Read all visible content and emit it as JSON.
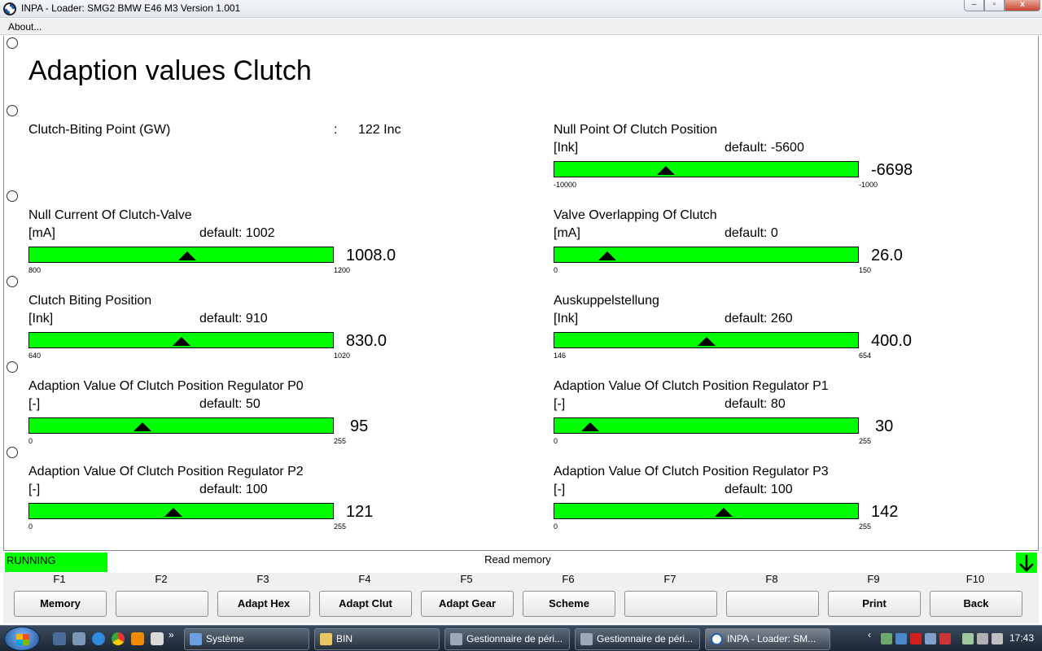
{
  "window": {
    "title": "INPA - Loader:  SMG2 BMW E46 M3 Version 1.001"
  },
  "menu": {
    "about": "About..."
  },
  "page": {
    "title": "Adaption values Clutch"
  },
  "biting_point": {
    "label": "Clutch-Biting Point (GW)",
    "sep": ":",
    "value": "122 Inc"
  },
  "gauges": [
    {
      "name": "Null Point Of Clutch Position",
      "unit": "[Ink]",
      "default": "default: -5600",
      "min": "-10000",
      "max": "-1000",
      "value": "-6698",
      "fraction": 0.367
    },
    {
      "name": "Null Current Of Clutch-Valve",
      "unit": "[mA]",
      "default": "default: 1002",
      "min": "800",
      "max": "1200",
      "value": "1008.0",
      "fraction": 0.52
    },
    {
      "name": "Valve Overlapping Of Clutch",
      "unit": "[mA]",
      "default": "default: 0",
      "min": "0",
      "max": "150",
      "value": "26.0",
      "fraction": 0.173
    },
    {
      "name": "Clutch Biting Position",
      "unit": "[Ink]",
      "default": "default: 910",
      "min": "640",
      "max": "1020",
      "value": "830.0",
      "fraction": 0.5
    },
    {
      "name": "Auskuppelstellung",
      "unit": "[Ink]",
      "default": "default: 260",
      "min": "146",
      "max": "654",
      "value": "400.0",
      "fraction": 0.5
    },
    {
      "name": "Adaption Value Of Clutch Position Regulator P0",
      "unit": "[-]",
      "default": "default: 50",
      "min": "0",
      "max": "255",
      "value": "95",
      "fraction": 0.373
    },
    {
      "name": "Adaption Value Of Clutch Position Regulator P1",
      "unit": "[-]",
      "default": "default: 80",
      "min": "0",
      "max": "255",
      "value": "30",
      "fraction": 0.118
    },
    {
      "name": "Adaption Value Of Clutch Position Regulator P2",
      "unit": "[-]",
      "default": "default: 100",
      "min": "0",
      "max": "255",
      "value": "121",
      "fraction": 0.475
    },
    {
      "name": "Adaption Value Of Clutch Position Regulator P3",
      "unit": "[-]",
      "default": "default: 100",
      "min": "0",
      "max": "255",
      "value": "142",
      "fraction": 0.557
    }
  ],
  "status": {
    "state": "RUNNING",
    "message": "Read memory"
  },
  "fkeys": [
    {
      "key": "F1",
      "label": "Memory"
    },
    {
      "key": "F2",
      "label": ""
    },
    {
      "key": "F3",
      "label": "Adapt Hex"
    },
    {
      "key": "F4",
      "label": "Adapt Clut"
    },
    {
      "key": "F5",
      "label": "Adapt Gear"
    },
    {
      "key": "F6",
      "label": "Scheme"
    },
    {
      "key": "F7",
      "label": ""
    },
    {
      "key": "F8",
      "label": ""
    },
    {
      "key": "F9",
      "label": "Print"
    },
    {
      "key": "F10",
      "label": "Back"
    }
  ],
  "taskbar": {
    "more": "»",
    "tasks": [
      "Système",
      "BIN",
      "Gestionnaire de péri...",
      "Gestionnaire de péri...",
      "INPA - Loader:  SM..."
    ],
    "clock": "17:43"
  }
}
